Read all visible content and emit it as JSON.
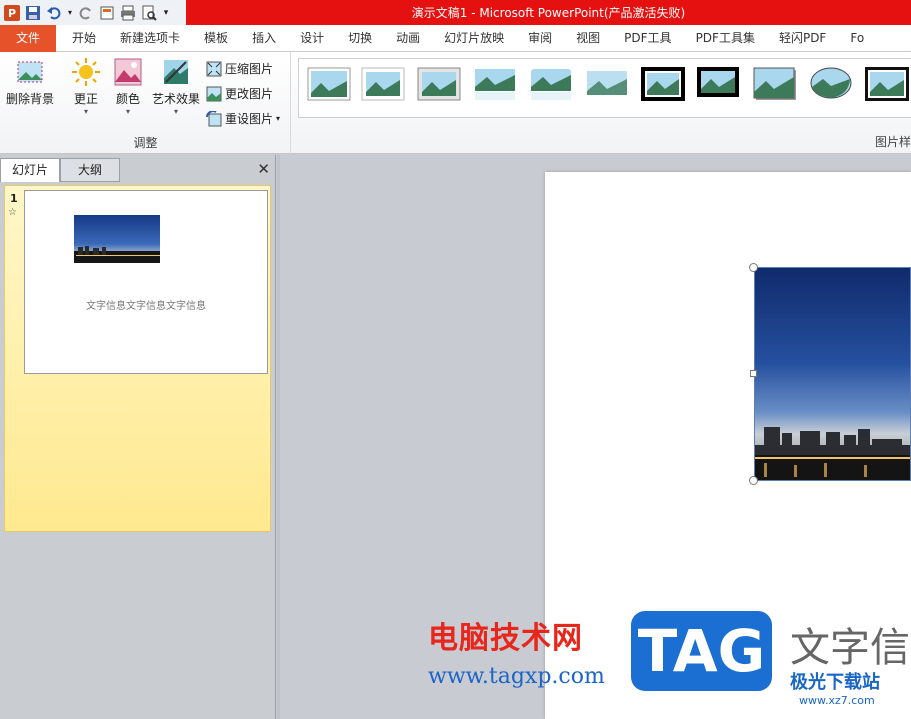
{
  "window": {
    "title": "演示文稿1 - Microsoft PowerPoint(产品激活失败)"
  },
  "tabs": [
    "文件",
    "开始",
    "新建选项卡",
    "模板",
    "插入",
    "设计",
    "切换",
    "动画",
    "幻灯片放映",
    "审阅",
    "视图",
    "PDF工具",
    "PDF工具集",
    "轻闪PDF",
    "Fo"
  ],
  "ribbon": {
    "remove_bg": "删除背景",
    "corrections": "更正",
    "color": "颜色",
    "art_effects": "艺术效果",
    "compress": "压缩图片",
    "change": "更改图片",
    "reset": "重设图片",
    "adjust_group": "调整",
    "styles_group": "图片样"
  },
  "left_pane": {
    "tab_slides": "幻灯片",
    "tab_outline": "大纲",
    "close": "✕",
    "slide_number": "1",
    "slide_star": "☆",
    "thumb_text": "文字信息文字信息文字信息"
  },
  "watermark": {
    "site_cn": "电脑技术网",
    "site_url": "www.tagxp.com",
    "tag": "TAG",
    "big_text": "文字信",
    "brand2": "极光下载站",
    "brand2_url": "www.xz7.com"
  },
  "colors": {
    "file_tab": "#e6532a",
    "title_bar": "#e51010",
    "tag_blue": "#1b6fd3"
  }
}
